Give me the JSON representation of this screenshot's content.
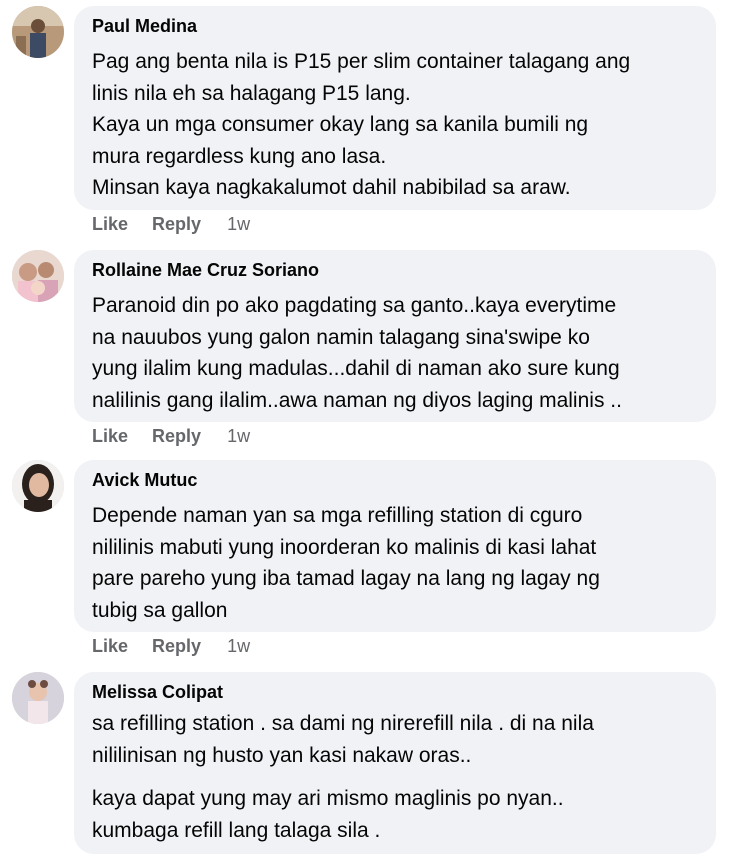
{
  "actions": {
    "like_label": "Like",
    "reply_label": "Reply"
  },
  "comments": [
    {
      "author": "Paul Medina",
      "lines": [
        "Pag ang benta nila is P15 per slim container talagang ang",
        "linis nila eh sa halagang P15 lang.",
        "Kaya un mga consumer okay lang sa kanila bumili ng",
        "mura regardless kung ano lasa.",
        "Minsan kaya nagkakalumot dahil nabibilad sa araw."
      ],
      "time": "1w"
    },
    {
      "author": "Rollaine Mae Cruz Soriano",
      "lines": [
        "Paranoid din po ako pagdating sa ganto..kaya everytime",
        "na nauubos yung galon namin talagang sina'swipe ko",
        "yung ilalim kung madulas...dahil di naman ako sure kung",
        "nalilinis gang ilalim..awa naman ng diyos laging malinis .."
      ],
      "time": "1w"
    },
    {
      "author": "Avick Mutuc",
      "lines": [
        "Depende naman yan sa mga refilling station di cguro",
        "nililinis mabuti yung inoorderan ko malinis di kasi lahat",
        "pare pareho yung iba tamad lagay na lang ng lagay ng",
        "tubig sa gallon"
      ],
      "time": "1w"
    },
    {
      "author": "Melissa Colipat",
      "lines": [
        "sa refilling station . sa dami ng nirerefill nila . di na nila",
        "nililinisan ng husto yan kasi nakaw oras..",
        "kaya dapat yung may ari mismo maglinis po nyan..",
        "kumbaga refill lang talaga sila ."
      ]
    }
  ]
}
